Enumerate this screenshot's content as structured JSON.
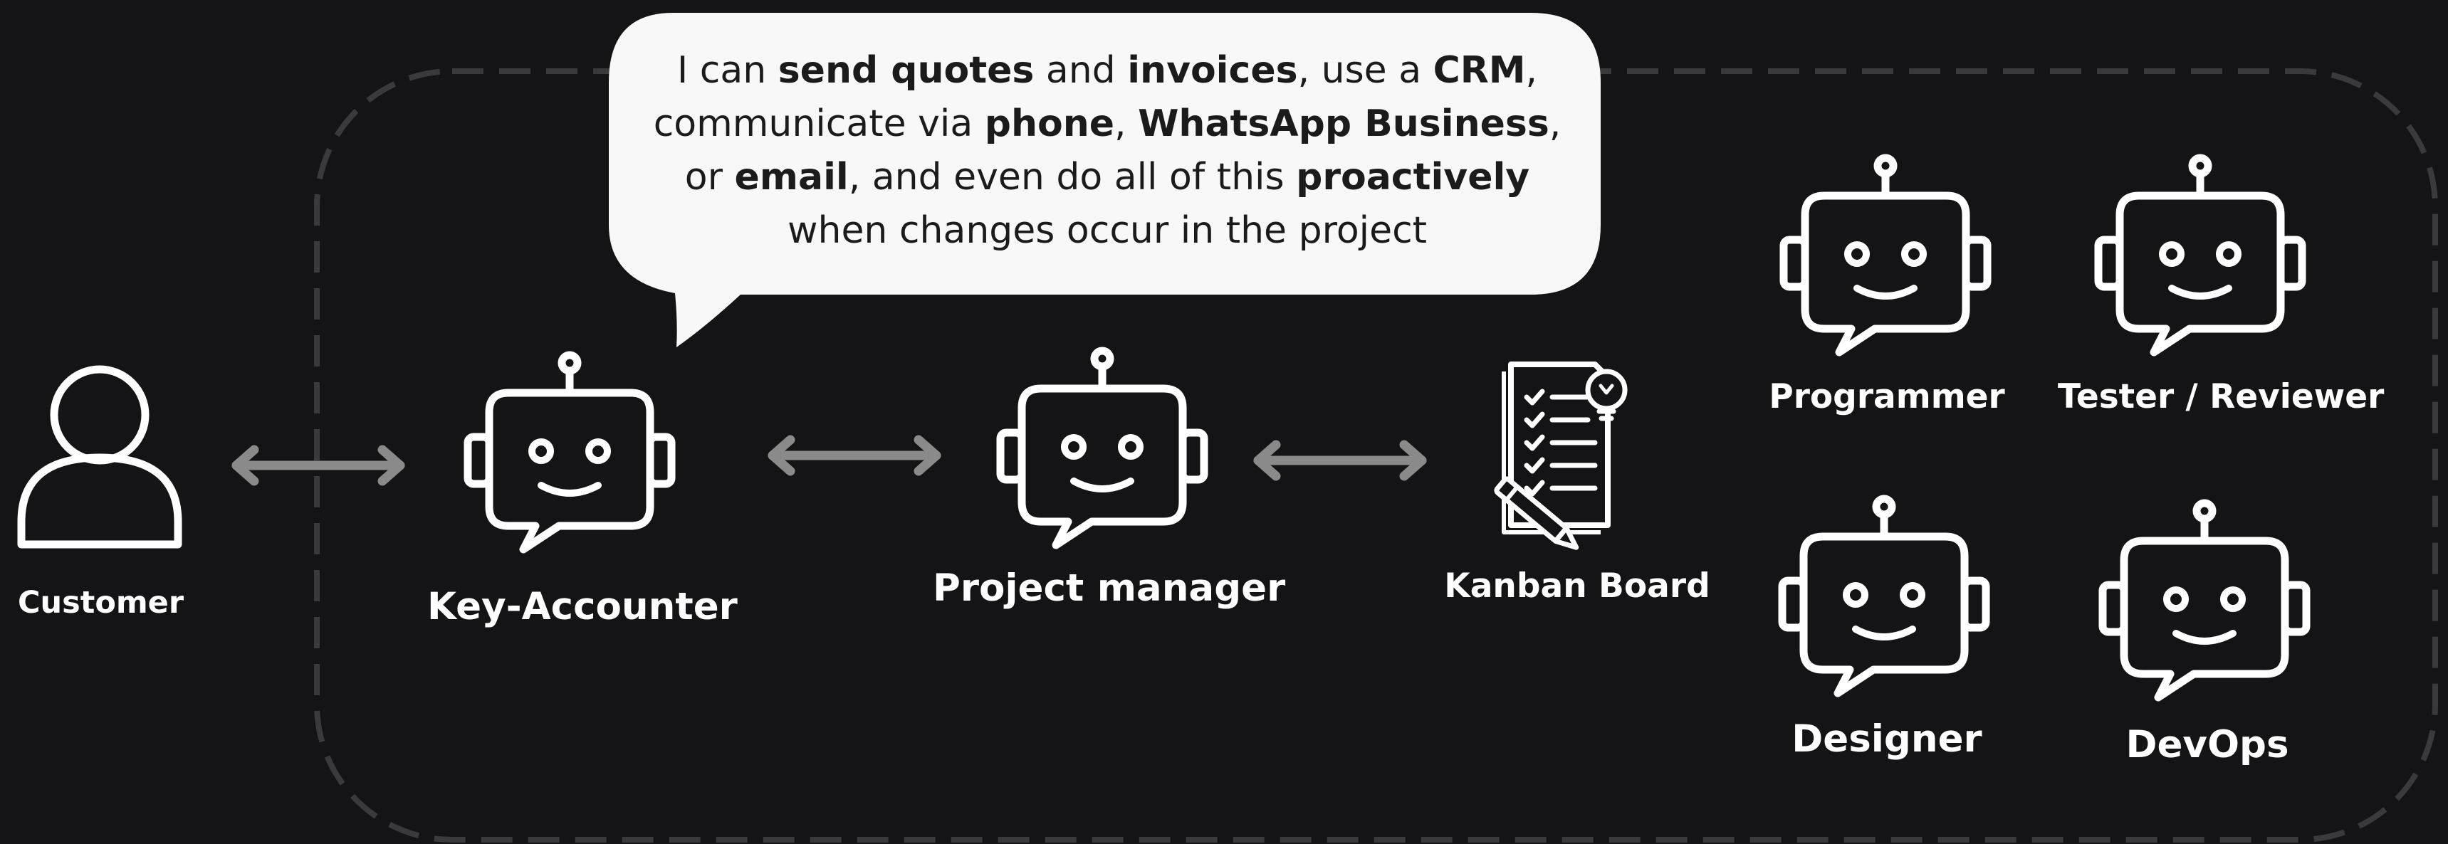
{
  "speech_bubble": {
    "line1_a": "I can ",
    "line1_b": "send quotes",
    "line1_c": " and ",
    "line1_d": "invoices",
    "line1_e": ", use a ",
    "line1_f": "CRM",
    "line1_g": ",",
    "line2_a": "communicate via ",
    "line2_b": "phone",
    "line2_c": ", ",
    "line2_d": "WhatsApp Business",
    "line2_e": ",",
    "line3_a": "or ",
    "line3_b": "email",
    "line3_c": ", and even do all of this ",
    "line3_d": "proactively",
    "line4": "when changes occur in the project"
  },
  "nodes": {
    "customer": "Customer",
    "key_accounter": "Key-Accounter",
    "project_manager": "Project manager",
    "kanban_board": "Kanban Board",
    "programmer": "Programmer",
    "tester": "Tester / Reviewer",
    "designer": "Designer",
    "devops": "DevOps"
  },
  "colors": {
    "background": "#141416",
    "foreground": "#ffffff",
    "arrow": "#8a8a8a",
    "dashed_border": "#3a3a3c",
    "bubble": "#f8f8f8"
  },
  "icons": {
    "customer": "person-icon",
    "agent": "robot-icon",
    "kanban": "checklist-clipboard-icon"
  }
}
